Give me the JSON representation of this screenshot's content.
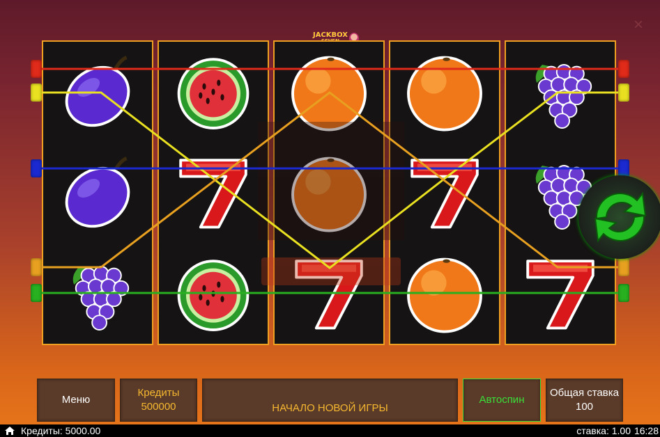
{
  "logo": {
    "line1": "JACKBOX",
    "line2": "SEVEN"
  },
  "reels": [
    [
      "plum",
      "plum",
      "grapes"
    ],
    [
      "watermelon",
      "seven",
      "watermelon"
    ],
    [
      "orange",
      "orange",
      "seven"
    ],
    [
      "orange",
      "seven",
      "orange"
    ],
    [
      "grapes",
      "grapes",
      "seven"
    ]
  ],
  "paylines": [
    {
      "color": "#e02a1a"
    },
    {
      "color": "#e8e020"
    },
    {
      "color": "#1a2ad0"
    },
    {
      "color": "#e8a020"
    },
    {
      "color": "#28b020"
    }
  ],
  "buttons": {
    "menu": "Меню",
    "credits_label": "Кредиты",
    "credits_value": "500000",
    "new_game": "НАЧАЛО НОВОЙ ИГРЫ",
    "autospin": "Автоспин",
    "total_bet_label": "Общая ставка",
    "total_bet_value": "100"
  },
  "status_bar": {
    "credits": "Кредиты: 5000.00",
    "bet": "ставка: 1.00",
    "time": "16:28"
  },
  "colors": {
    "button_text_gold": "#f5b830",
    "button_text_white": "#ffffff",
    "autospin_green": "#3ae03a",
    "reel_border": "#f0a020"
  }
}
